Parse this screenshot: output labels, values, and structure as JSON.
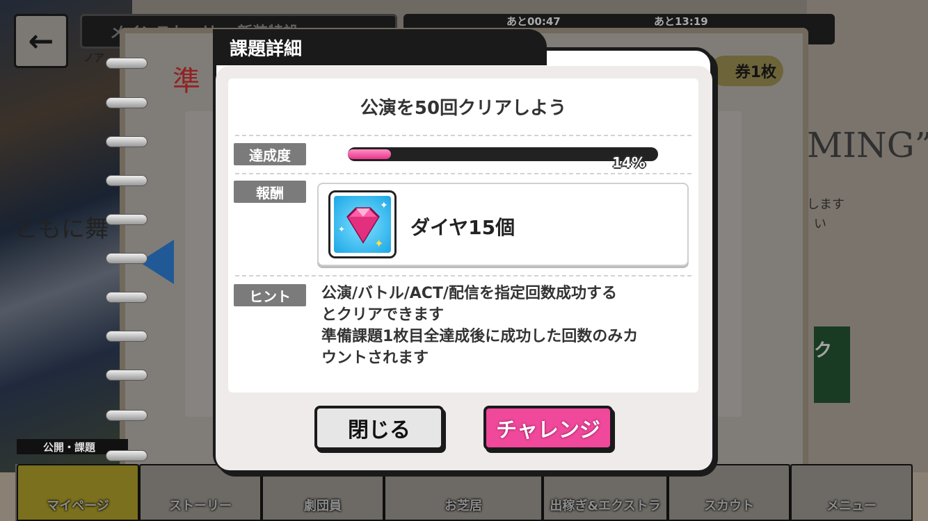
{
  "background": {
    "top_title": "メインストーリー 新装特設",
    "top_sub": "ノア",
    "timer_1": "あと00:47",
    "timer_2": "あと13:19",
    "ticket_badge": "券1枚",
    "deco_ming": "MING”",
    "deco_side_1": "します",
    "deco_side_2": "い",
    "deco_left": "ともに舞",
    "deco_red": "準",
    "left_caption": "公開・課題",
    "challenge_partial": "ク"
  },
  "bottom_nav": [
    {
      "label": "マイページ"
    },
    {
      "label": "ストーリー"
    },
    {
      "label": "劇団員"
    },
    {
      "label": "お芝居"
    },
    {
      "label": "出稼ぎ&エクストラ"
    },
    {
      "label": "スカウト"
    },
    {
      "label": "メニュー"
    }
  ],
  "dialog": {
    "tab_title": "課題詳細",
    "mission_title": "公演を50回クリアしよう",
    "progress": {
      "label": "達成度",
      "percent_text": "14%",
      "value": 0.14
    },
    "reward": {
      "label": "報酬",
      "name": "ダイヤ15個",
      "icon": "diamond-icon"
    },
    "hint": {
      "label": "ヒント",
      "text": "公演/バトル/ACT/配信を指定回数成功する\nとクリアできます\n準備課題1枚目全達成後に成功した回数のみカ\nウントされます"
    },
    "buttons": {
      "close": "閉じる",
      "challenge": "チャレンジ"
    }
  },
  "colors": {
    "accent_pink": "#f0489b",
    "dialog_border": "#1a1a1a",
    "label_gray": "#7b7b7b"
  }
}
